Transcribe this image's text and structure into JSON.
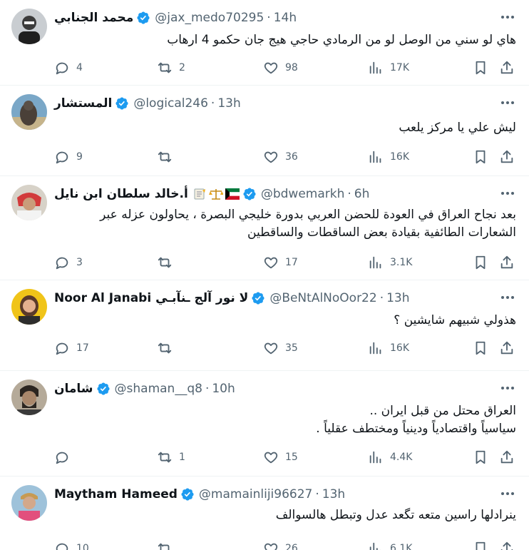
{
  "colors": {
    "text": "#0f1419",
    "muted": "#536471",
    "verified": "#1d9bf0",
    "divider": "#eff3f4"
  },
  "icons": [
    "more-icon",
    "verified-badge-icon",
    "reply-icon",
    "retweet-icon",
    "like-icon",
    "views-icon",
    "bookmark-icon",
    "share-icon"
  ],
  "tweets": [
    {
      "name": "محمد الجنابي",
      "handle": "@jax_medo70295",
      "separator": "·",
      "time": "14h",
      "text": [
        "هاي لو سني من الوصل لو من الرمادي حاجي هيج جان حكمو 4 ارهاب"
      ],
      "replies": "4",
      "retweets": "2",
      "likes": "98",
      "views": "17K"
    },
    {
      "name": "المستشار",
      "handle": "@logical246",
      "separator": "·",
      "time": "13h",
      "text": [
        "ليش علي يا مركز يلعب"
      ],
      "replies": "9",
      "retweets": "",
      "likes": "36",
      "views": "16K"
    },
    {
      "name": "أ.خالد سلطان ابن نايل",
      "name_emoji": [
        "memo-emoji",
        "balance-scale-emoji",
        "kuwait-flag-emoji"
      ],
      "handle": "@bdwemarkh",
      "separator": "·",
      "time": "6h",
      "text": [
        "بعد نجاح العراق في العودة للحضن العربي بدورة خليجي البصرة ، يحاولون عزله عبر",
        "الشعارات الطائفية بقيادة بعض الساقطات والساقطين"
      ],
      "replies": "3",
      "retweets": "",
      "likes": "17",
      "views": "3.1K"
    },
    {
      "name": "Noor Al Janabi ﻻ نور آلج ـنآبـي",
      "handle": "@BeNtAlNoOor22",
      "separator": "·",
      "time": "13h",
      "text": [
        "هذولي شبيهم شايشين ؟"
      ],
      "replies": "17",
      "retweets": "",
      "likes": "35",
      "views": "16K"
    },
    {
      "name": "شامان",
      "handle": "@shaman__q8",
      "separator": "·",
      "time": "10h",
      "text": [
        "العراق محتل من قبل ايران ..",
        "سياسياً واقتصادياً ودينياً ومختطف عقلياً ."
      ],
      "replies": "",
      "retweets": "1",
      "likes": "15",
      "views": "4.4K"
    },
    {
      "name": "Maytham Hameed",
      "handle": "@mamainliji96627",
      "separator": "·",
      "time": "13h",
      "text": [
        "ينرادلها راسين متعه تگعد عدل وتبطل هالسوالف"
      ],
      "replies": "10",
      "retweets": "",
      "likes": "26",
      "views": "6.1K"
    }
  ]
}
